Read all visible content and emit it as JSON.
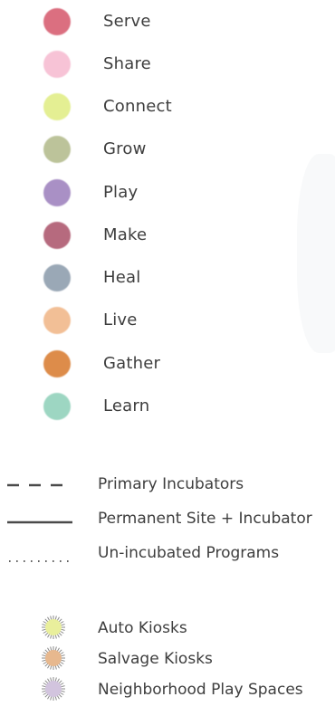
{
  "categories": [
    {
      "label": "Serve",
      "color": "#db6f80"
    },
    {
      "label": "Share",
      "color": "#f7c3d6"
    },
    {
      "label": "Connect",
      "color": "#e4ef93"
    },
    {
      "label": "Grow",
      "color": "#bcc39a"
    },
    {
      "label": "Play",
      "color": "#a990c5"
    },
    {
      "label": "Make",
      "color": "#b66a7e"
    },
    {
      "label": "Heal",
      "color": "#9aa8b6"
    },
    {
      "label": "Live",
      "color": "#f2bf96"
    },
    {
      "label": "Gather",
      "color": "#dd8c4a"
    },
    {
      "label": "Learn",
      "color": "#9dd6c2"
    }
  ],
  "line_styles": [
    {
      "label": "Primary Incubators",
      "style": "dashed"
    },
    {
      "label": "Permanent Site + Incubator",
      "style": "solid"
    },
    {
      "label": "Un-incubated Programs",
      "style": "dotted"
    }
  ],
  "kiosks": [
    {
      "label": "Auto Kiosks",
      "color": "#e9ef9c"
    },
    {
      "label": "Salvage Kiosks",
      "color": "#e7b88e"
    },
    {
      "label": "Neighborhood Play Spaces",
      "color": "#d2c4de"
    }
  ]
}
